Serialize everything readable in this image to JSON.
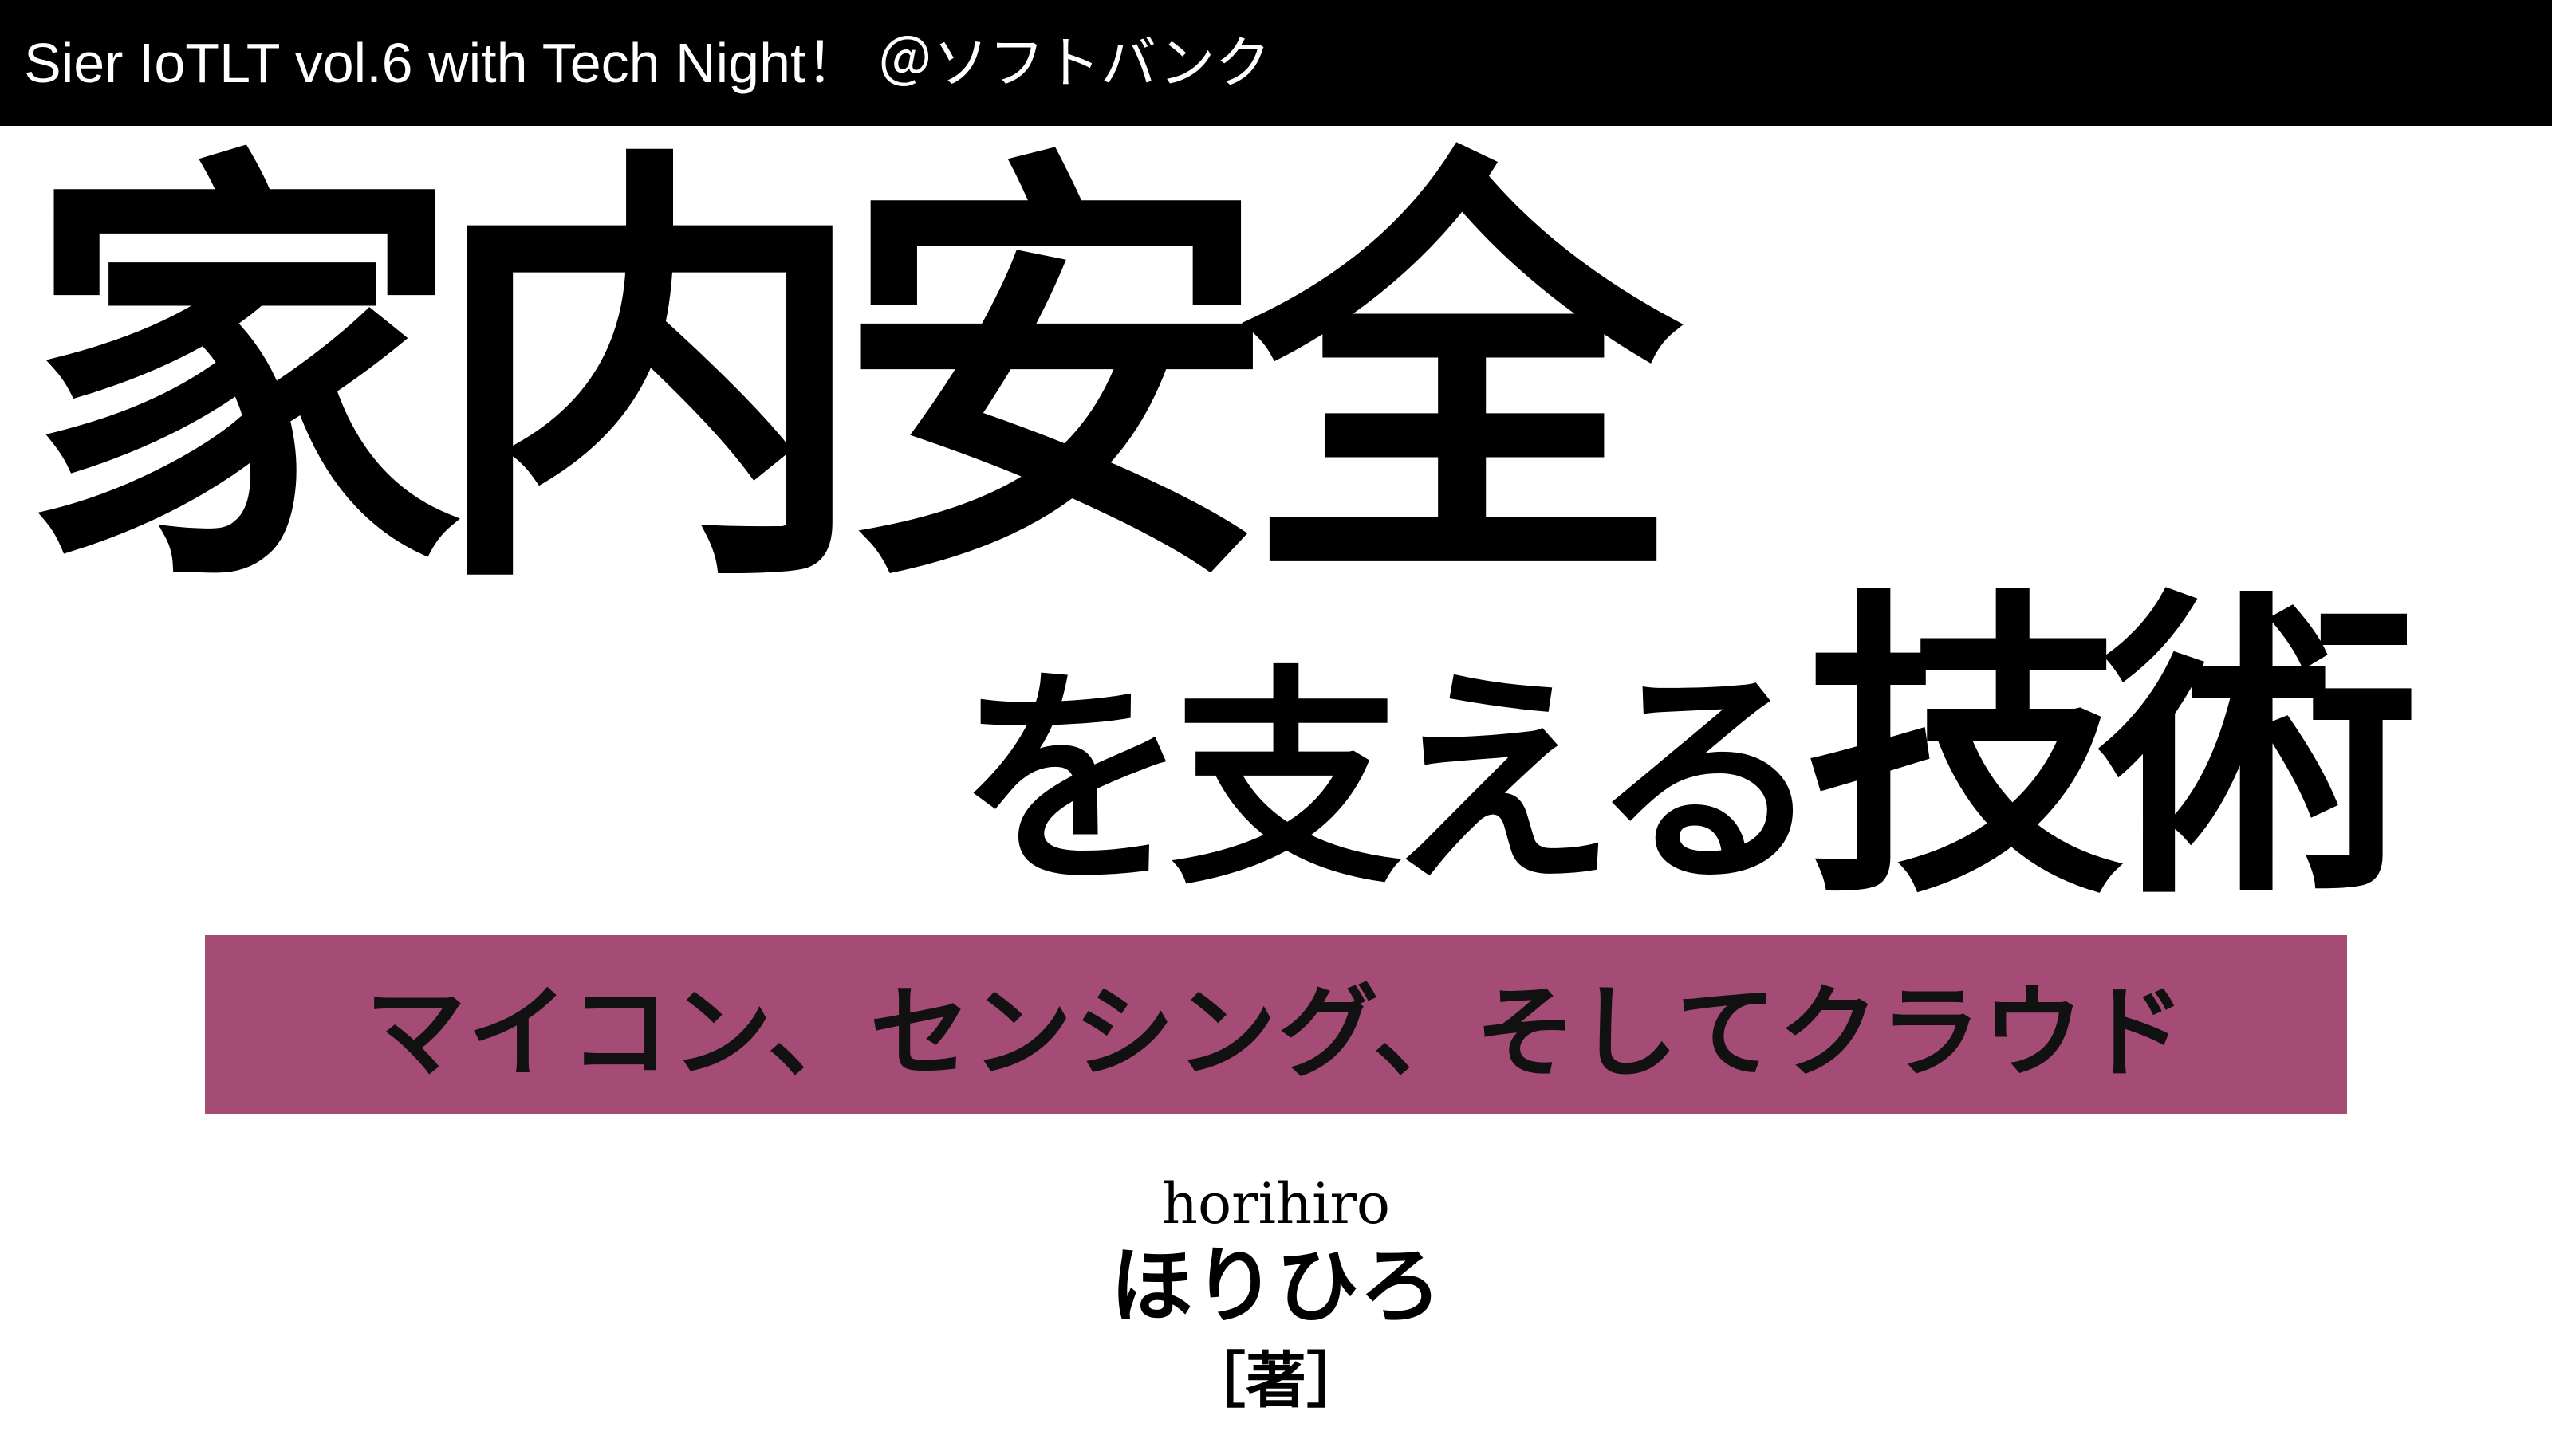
{
  "header": {
    "event_title": "Sier IoTLT vol.6 with Tech Night！ ＠ソフトバンク"
  },
  "title": {
    "line1": "家内安全",
    "line2_kana": "を支える",
    "line2_kanji": "技術"
  },
  "subtitle": {
    "text": "マイコン、センシング、そしてクラウド"
  },
  "author": {
    "romaji": "horihiro",
    "name": "ほりひろ",
    "role": "［著］"
  },
  "colors": {
    "header_bg": "#000000",
    "header_text": "#ffffff",
    "subtitle_band": "#a44c75",
    "title_text": "#000000"
  }
}
